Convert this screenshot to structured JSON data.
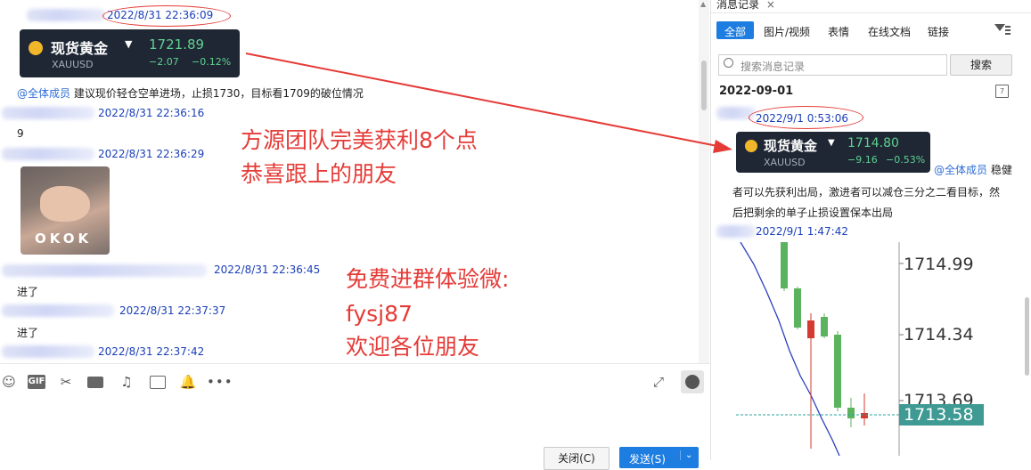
{
  "left_chat": {
    "messages": [
      {
        "time": "2022/8/31 22:36:09"
      },
      {
        "mention": "@全体成员",
        "text": "建议现价轻仓空单进场，止损1730，目标看1709的破位情况"
      },
      {
        "time": "2022/8/31 22:36:16",
        "text": "9"
      },
      {
        "time": "2022/8/31 22:36:29",
        "image_caption": "OKOK"
      },
      {
        "time": "2022/8/31 22:36:45",
        "text": "进了"
      },
      {
        "time": "2022/8/31 22:37:37",
        "text": "进了"
      },
      {
        "time": "2022/8/31 22:37:42"
      }
    ],
    "quote_card": {
      "name": "现货黄金",
      "symbol": "XAUUSD",
      "price": "1721.89",
      "change": "−2.07",
      "change_pct": "−0.12%"
    },
    "overlay": {
      "line1": "方源团队完美获利8个点",
      "line2": "恭喜跟上的朋友",
      "line3": "免费进群体验微:",
      "line4": "fysj87",
      "line5": "欢迎各位朋友"
    },
    "buttons": {
      "close": "关闭(C)",
      "send": "发送(S)"
    }
  },
  "right_panel": {
    "title": "消息记录",
    "close_glyph": "×",
    "tabs": [
      "全部",
      "图片/视频",
      "表情",
      "在线文档",
      "链接"
    ],
    "search_placeholder": "搜索消息记录",
    "search_button": "搜索",
    "date": "2022-09-01",
    "msg1_time": "2022/9/1 0:53:06",
    "quote_card": {
      "name": "现货黄金",
      "symbol": "XAUUSD",
      "price": "1714.80",
      "change": "−9.16",
      "change_pct": "−0.53%"
    },
    "msg1_mention": "@全体成员",
    "msg1_line1": "稳健",
    "msg1_line2": "者可以先获利出局，激进者可以减仓三分之二看目标，然",
    "msg1_line3": "后把剩余的单子止损设置保本出局",
    "msg2_time": "2022/9/1 1:47:42",
    "chart_labels": [
      "1714.99",
      "1714.34",
      "1713.69",
      "1713.58"
    ]
  },
  "colors": {
    "accent": "#1e7de0",
    "annotation": "#e53b37",
    "up": "#5fd190"
  }
}
